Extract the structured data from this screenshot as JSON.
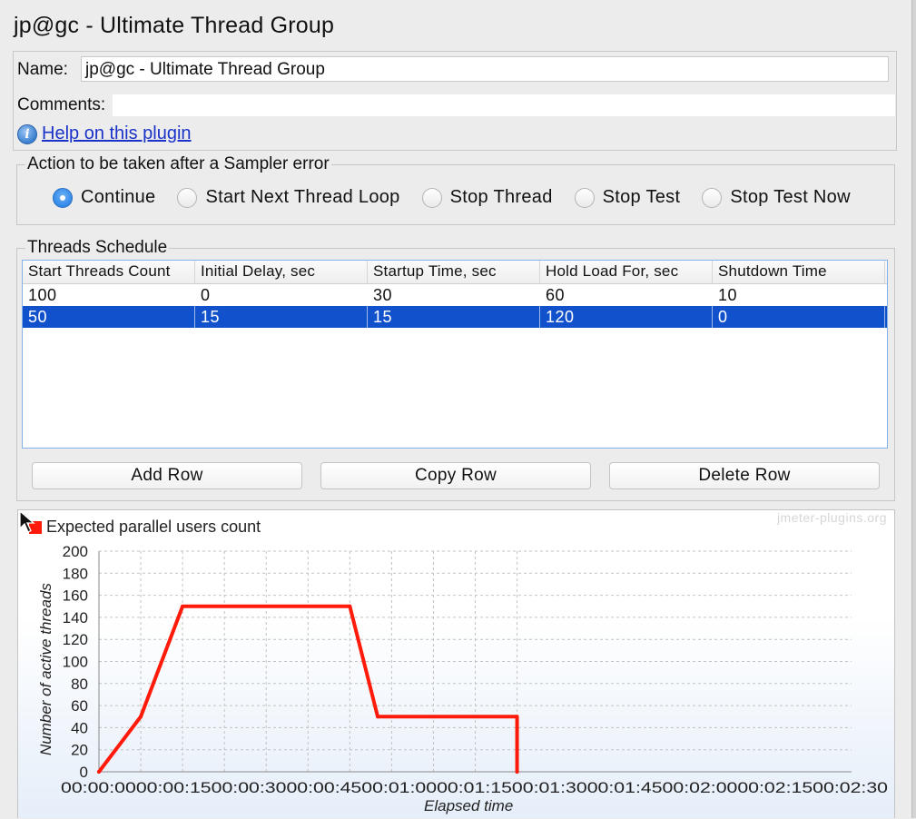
{
  "window": {
    "title": "jp@gc - Ultimate Thread Group"
  },
  "name_panel": {
    "name_label": "Name:",
    "name_value": "jp@gc - Ultimate Thread Group",
    "comments_label": "Comments:",
    "comments_value": "",
    "help_icon": "info-icon",
    "help_link": "Help on this plugin"
  },
  "sampler_error": {
    "legend": "Action to be taken after a Sampler error",
    "options": [
      "Continue",
      "Start Next Thread Loop",
      "Stop Thread",
      "Stop Test",
      "Stop Test Now"
    ],
    "selected": "Continue"
  },
  "schedule": {
    "legend": "Threads Schedule",
    "columns": [
      "Start Threads Count",
      "Initial Delay, sec",
      "Startup Time, sec",
      "Hold Load For, sec",
      "Shutdown Time"
    ],
    "rows": [
      [
        "100",
        "0",
        "30",
        "60",
        "10"
      ],
      [
        "50",
        "15",
        "15",
        "120",
        "0"
      ]
    ],
    "selected_row": 1,
    "buttons": {
      "add": "Add Row",
      "copy": "Copy Row",
      "delete": "Delete Row"
    }
  },
  "colors": {
    "series": "#ff1a0a",
    "selection": "#1251cc",
    "accent": "#2d86e8"
  },
  "chart_data": {
    "type": "line",
    "watermark": "jmeter-plugins.org",
    "xlabel": "Elapsed time",
    "ylabel": "Number of active threads",
    "ylim": [
      0,
      200
    ],
    "xlim": [
      0,
      270
    ],
    "grid": true,
    "legend_position": "top-left",
    "yticks": [
      0,
      20,
      40,
      60,
      80,
      100,
      120,
      140,
      160,
      180,
      200
    ],
    "xticks": [
      0,
      15,
      30,
      45,
      60,
      75,
      90,
      105,
      120,
      135,
      150
    ],
    "xtick_labels": [
      "00:00:00",
      "00:00:15",
      "00:00:30",
      "00:00:45",
      "00:01:00",
      "00:01:15",
      "00:01:30",
      "00:01:45",
      "00:02:00",
      "00:02:15",
      "00:02:30"
    ],
    "xtick_label_text": "00:00:0000:00:1500:00:3000:00:4500:01:0000:01:1500:01:3000:01:4500:02:0000:02:1500:02:30",
    "series": [
      {
        "name": "Expected parallel users count",
        "x": [
          0,
          15,
          30,
          90,
          100,
          150,
          150
        ],
        "y": [
          0,
          50,
          150,
          150,
          50,
          50,
          0
        ]
      }
    ]
  }
}
